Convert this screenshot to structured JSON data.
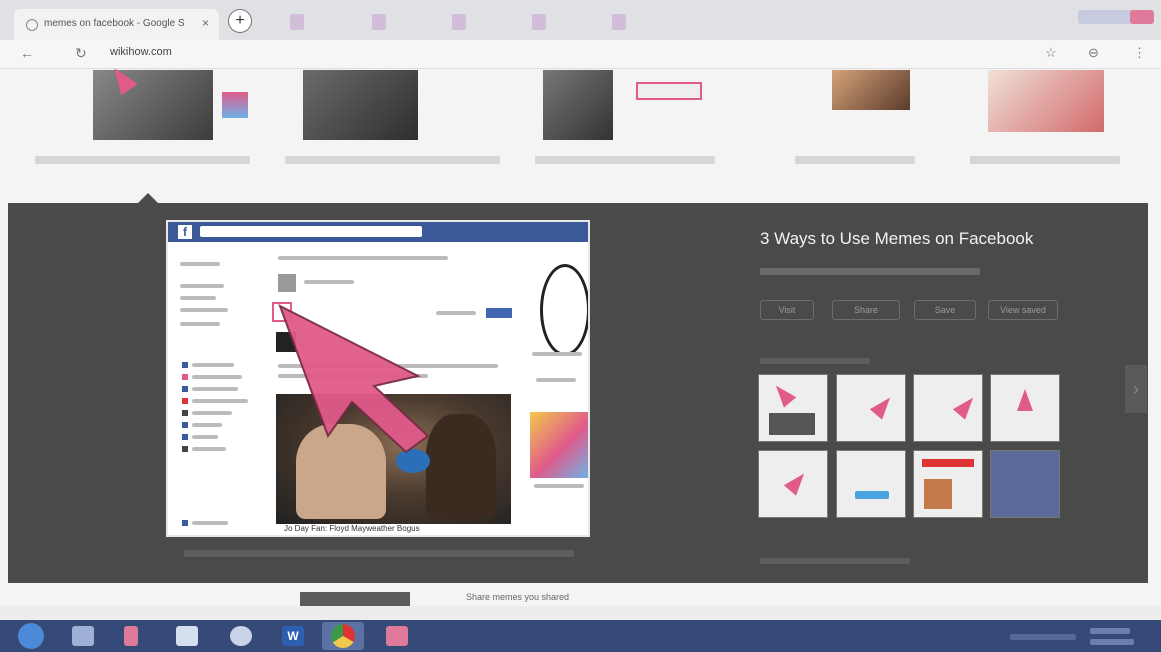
{
  "browser": {
    "tab_title": "memes on facebook - Google S",
    "tab_close": "×",
    "new_tab": "+",
    "url": "wikihow.com",
    "nav_back": "←",
    "nav_reload": "↻",
    "icon_star": "☆",
    "icon_account": "⊖",
    "icon_menu": "⋮"
  },
  "viewer": {
    "title": "3 Ways to Use Memes on Facebook",
    "next_arrow": "›",
    "buttons": [
      "Visit",
      "Share",
      "Save",
      "View saved"
    ]
  },
  "main_image": {
    "caption": "Jo Day Fan: Floyd Mayweather Bogus"
  },
  "bottom_strip": {
    "text": "Share memes you shared"
  },
  "taskbar": {
    "word_label": "W"
  },
  "colors": {
    "accent_pink": "#e05a8a",
    "facebook_blue": "#3b5998",
    "overlay": "#4a4a4a",
    "taskbar": "#364a78"
  }
}
